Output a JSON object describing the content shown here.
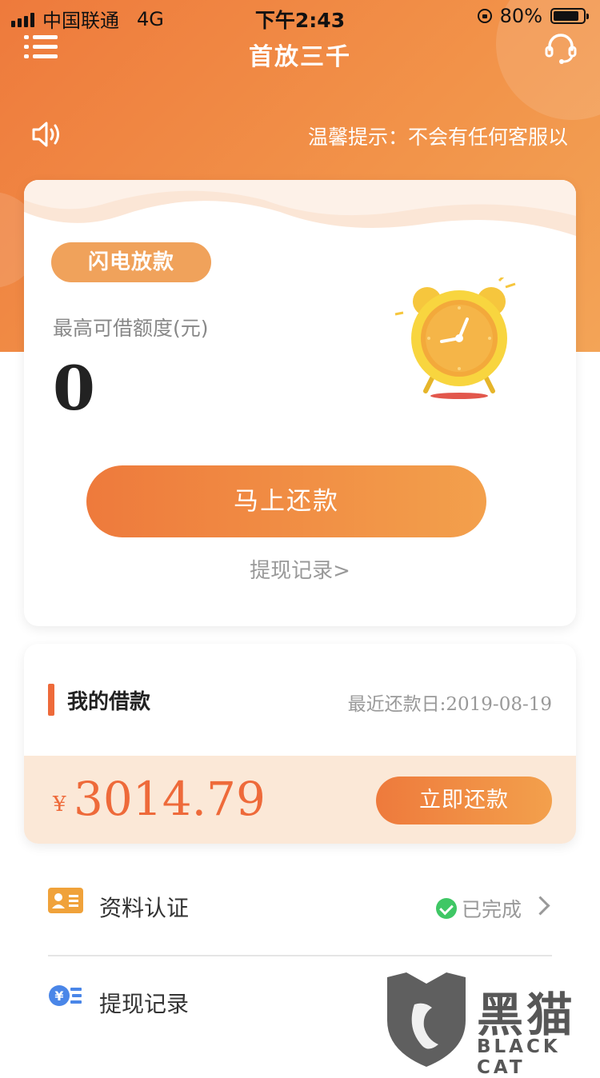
{
  "status_bar": {
    "carrier": "中国联通",
    "network": "4G",
    "time": "下午2:43",
    "battery": "80%",
    "battery_level": 0.8
  },
  "header": {
    "title": "首放三千",
    "notice": "温馨提示：不会有任何客服以"
  },
  "main_card": {
    "badge": "闪电放款",
    "limit_label": "最高可借额度(元)",
    "limit_value": "0",
    "primary_button": "马上还款",
    "records_link": "提现记录>"
  },
  "loan_card": {
    "title": "我的借款",
    "recent_repay": "最近还款日:2019-08-19",
    "currency": "¥",
    "amount": "3014.79",
    "repay_button": "立即还款"
  },
  "list": [
    {
      "label": "资料认证",
      "status": "已完成",
      "icon": "id-card-icon"
    },
    {
      "label": "提现记录",
      "icon": "yuan-list-icon"
    }
  ],
  "watermark": {
    "text": "黑猫",
    "sub": "BLACK CAT"
  },
  "colors": {
    "accent": "#ee7a3c",
    "accent_light": "#f3a04c",
    "loan_bg": "#fbe8d7",
    "success": "#3fc765"
  }
}
